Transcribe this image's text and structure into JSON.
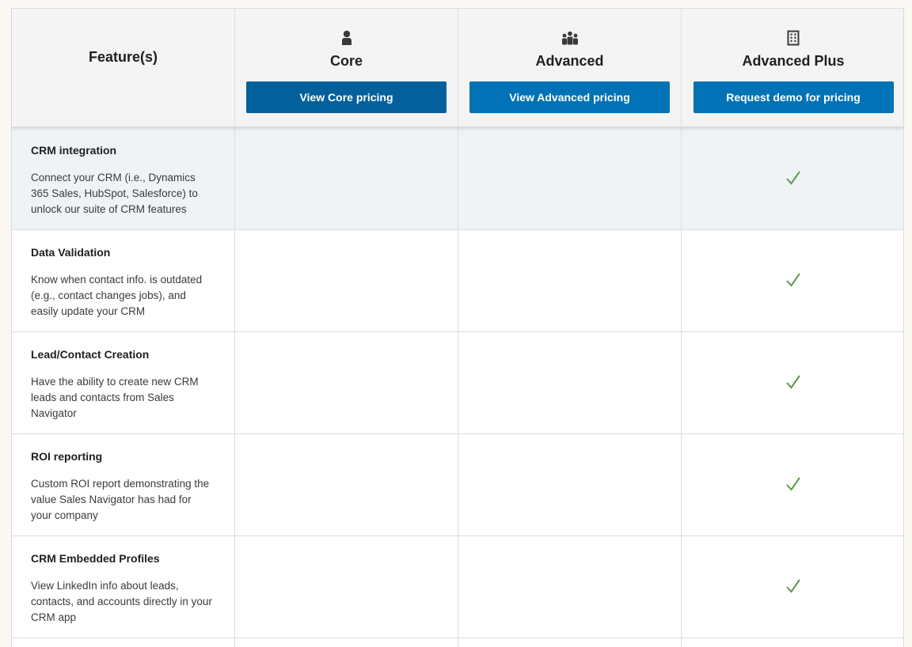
{
  "header": {
    "feature_label": "Feature(s)",
    "plans": [
      {
        "name": "Core",
        "icon": "person-icon",
        "button": "View Core pricing",
        "button_color": "#04609c"
      },
      {
        "name": "Advanced",
        "icon": "group-icon",
        "button": "View Advanced pricing",
        "button_color": "#0272b6"
      },
      {
        "name": "Advanced Plus",
        "icon": "building-icon",
        "button": "Request demo for pricing",
        "button_color": "#0272b6"
      }
    ]
  },
  "rows": [
    {
      "title": "CRM integration",
      "desc": "Connect your CRM (i.e., Dynamics 365 Sales, HubSpot, Salesforce) to unlock our suite of CRM features",
      "core": false,
      "advanced": false,
      "advanced_plus": true
    },
    {
      "title": "Data Validation",
      "desc": "Know when contact info. is outdated (e.g., contact changes jobs), and easily update your CRM",
      "core": false,
      "advanced": false,
      "advanced_plus": true
    },
    {
      "title": "Lead/Contact Creation",
      "desc": "Have the ability to create new CRM leads and contacts from Sales Navigator",
      "core": false,
      "advanced": false,
      "advanced_plus": true
    },
    {
      "title": "ROI reporting",
      "desc": "Custom ROI report demonstrating the value Sales Navigator has had for your company",
      "core": false,
      "advanced": false,
      "advanced_plus": true
    },
    {
      "title": "CRM Embedded Profiles",
      "desc": "View LinkedIn info about leads, contacts, and accounts directly in your CRM app",
      "core": false,
      "advanced": false,
      "advanced_plus": true
    }
  ],
  "colors": {
    "check": "#5b9a4a",
    "highlight_row": "#eff3f6",
    "header_bg": "#f4f4f4"
  }
}
